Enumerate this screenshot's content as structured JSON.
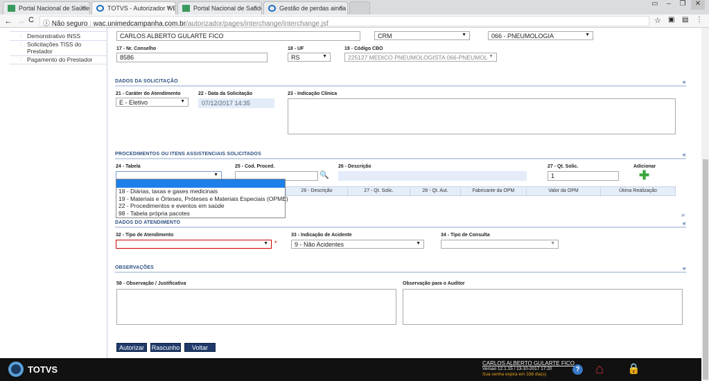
{
  "browser": {
    "tabs": [
      {
        "title": "Portal Nacional de Saúde",
        "icon": "portal-icon"
      },
      {
        "title": "TOTVS - Autorizador WE",
        "icon": "totvs-icon",
        "active": true
      },
      {
        "title": "Portal Nacional de Saúde",
        "icon": "portal-icon"
      },
      {
        "title": "Gestão de perdas ainda",
        "icon": "globe-icon"
      }
    ],
    "close_glyph": "×",
    "security": "Não seguro",
    "url_host": "wac.unimedcampanha.com.br",
    "url_path": "/autorizador/pages/interchange/interchange.jsf"
  },
  "sidebar": {
    "items": [
      {
        "label": "Demonstrativo INSS"
      },
      {
        "label": "Solicitações TISS do Prestador"
      },
      {
        "label": "Pagamento do Prestador"
      }
    ]
  },
  "profissional": {
    "nome": "CARLOS ALBERTO GULARTE FICO",
    "conselho": "CRM",
    "especialidade": "066 - PNEUMOLOGIA",
    "nr_conselho_label": "17 - Nr. Conselho",
    "nr_conselho": "8586",
    "uf_label": "18 - UF",
    "uf": "RS",
    "cbo_label": "19 - Código CBO",
    "cbo": "225127 MEDICO PNEUMOLOGISTA 066-PNEUMOL"
  },
  "solicitacao": {
    "title": "DADOS DA SOLICITAÇÃO",
    "collapse": "«",
    "carater_label": "21 - Caráter do Atendimento",
    "carater": "E - Eletivo",
    "data_label": "22 - Data da Solicitação",
    "data": "07/12/2017 14:35",
    "indicacao_label": "23 - Indicação Clínica",
    "indicacao": ""
  },
  "procedimentos": {
    "title": "PROCEDIMENTOS OU ITENS ASSISTENCIAIS SOLICITADOS",
    "collapse": "«",
    "expand": "»",
    "tabela_label": "24 - Tabela",
    "tabela": "",
    "cod_label": "25 - Cod. Proced.",
    "cod": "",
    "desc_label": "26 - Descrição",
    "desc": "",
    "qt_label": "27 - Qt. Solic.",
    "qt": "1",
    "adicionar": "Adicionar",
    "tabela_options": [
      "",
      "18 - Diárias, taxas e gases medicinais",
      "19 - Materiais e Órteses, Próteses e Materiais Especiais (OPME)",
      "22 - Procedimentos e eventos em saúde",
      "98 - Tabela própria pacotes"
    ],
    "columns": [
      "26 - Descrição",
      "27 - Qt. Solic.",
      "28 - Qt. Aut.",
      "Fabricante da OPM",
      "Valor da OPM",
      "Útima Realização"
    ]
  },
  "atendimento": {
    "title": "DADOS DO ATENDIMENTO",
    "collapse": "«",
    "tipo_label": "32 - Tipo de Atendimento",
    "tipo": "",
    "required": "*",
    "acidente_label": "33 - Indicação de Acidente",
    "acidente": "9 - Não Acidentes",
    "consulta_label": "34 - Tipo de Consulta",
    "consulta": ""
  },
  "observacoes": {
    "title": "OBSERVAÇÕES",
    "collapse": "«",
    "obs_label": "58 - Observação / Justificativa",
    "auditor_label": "Observação para o Auditor"
  },
  "actions": {
    "autorizar": "Autorizar",
    "rascunho": "Rascunho",
    "voltar": "Voltar"
  },
  "footer": {
    "logo": "TOTVS",
    "user": "CARLOS ALBERTO GULARTE FICO",
    "version": "Versao 12.1.15 / 13-10-2017 17:20",
    "password_warning": "Sua senha expira em 338 dia(s)",
    "warning_color": "#e8a317"
  }
}
